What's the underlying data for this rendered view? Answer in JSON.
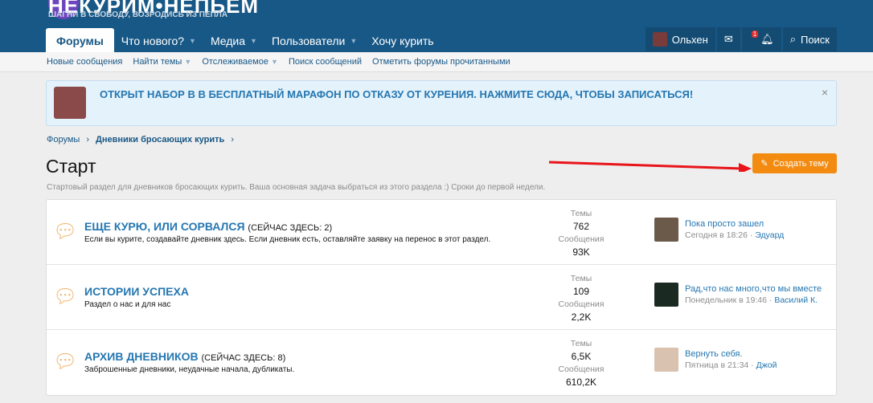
{
  "header": {
    "logo": "НЕКУРИМ•НЕПЬЕМ",
    "tagline": "ШАГНИ В СВОБОДУ, ВОЗРОДИСЬ ИЗ ПЕПЛА",
    "nav": [
      {
        "label": "Форумы"
      },
      {
        "label": "Что нового?"
      },
      {
        "label": "Медиа"
      },
      {
        "label": "Пользователи"
      },
      {
        "label": "Хочу курить"
      }
    ],
    "user": "Ольхен",
    "alerts_count": "1",
    "search": "Поиск"
  },
  "subnav": [
    "Новые сообщения",
    "Найти темы",
    "Отслеживаемое",
    "Поиск сообщений",
    "Отметить форумы прочитанными"
  ],
  "notice": {
    "text": "ОТКРЫТ НАБОР В В БЕСПЛАТНЫЙ МАРАФОН ПО ОТКАЗУ ОТ КУРЕНИЯ. НАЖМИТЕ СЮДА, ЧТОБЫ ЗАПИСАТЬСЯ!",
    "close": "×"
  },
  "breadcrumb": [
    "Форумы",
    "Дневники бросающих курить"
  ],
  "page": {
    "title": "Старт",
    "create_button": "Создать тему",
    "description": "Стартовый раздел для дневников бросающих курить. Ваша основная задача выбраться из этого раздела :) Сроки до первой недели."
  },
  "labels": {
    "threads": "Темы",
    "messages": "Сообщения"
  },
  "forums": [
    {
      "title": "ЕЩЕ КУРЮ, ИЛИ СОРВАЛСЯ",
      "here": "(СЕЙЧАС ЗДЕСЬ: 2)",
      "desc": "Если вы курите, создавайте дневник здесь. Если дневник есть, оставляйте заявку на перенос в этот раздел.",
      "threads": "762",
      "messages": "93K",
      "last_title": "Пока просто зашел",
      "last_date": "Сегодня в 18:26",
      "last_user": "Эдуард"
    },
    {
      "title": "ИСТОРИИ УСПЕХА",
      "here": "",
      "desc": "Раздел о нас и для нас",
      "threads": "109",
      "messages": "2,2K",
      "last_title": "Рад,что нас много,что мы вместе",
      "last_date": "Понедельник в 19:46",
      "last_user": "Василий К."
    },
    {
      "title": "АРХИВ ДНЕВНИКОВ",
      "here": "(СЕЙЧАС ЗДЕСЬ: 8)",
      "desc": "Заброшенные дневники, неудачные начала, дубликаты.",
      "threads": "6,5K",
      "messages": "610,2K",
      "last_title": "Вернуть себя.",
      "last_date": "Пятница в 21:34",
      "last_user": "Джой"
    }
  ]
}
